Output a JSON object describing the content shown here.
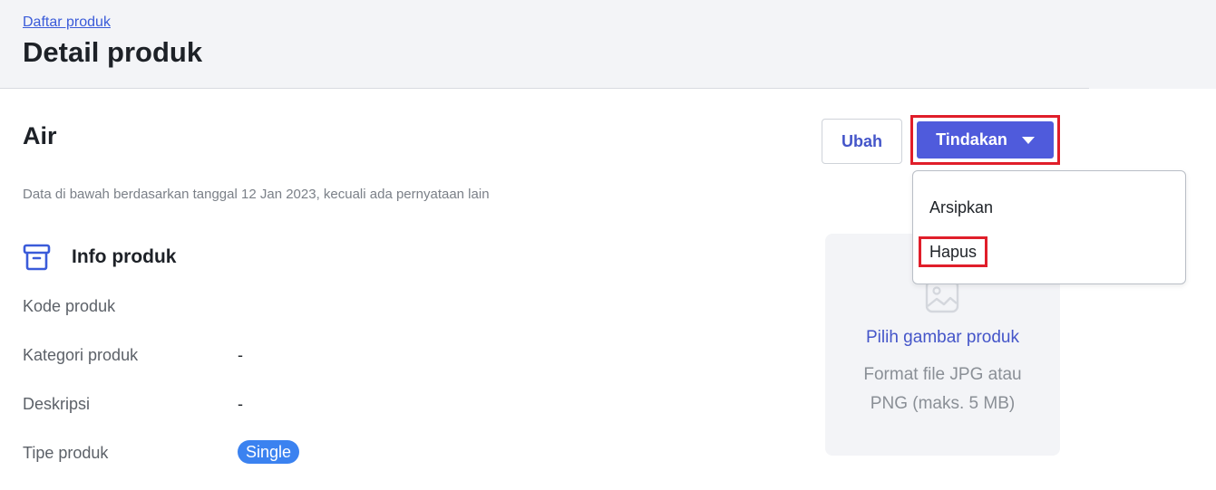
{
  "header": {
    "breadcrumb": "Daftar produk",
    "title": "Detail produk"
  },
  "product": {
    "name": "Air",
    "note": "Data di bawah berdasarkan tanggal 12 Jan 2023, kecuali ada pernyataan lain"
  },
  "actions": {
    "edit_label": "Ubah",
    "menu_label": "Tindakan",
    "menu_items": [
      "Arsipkan",
      "Hapus"
    ]
  },
  "info": {
    "section_title": "Info produk",
    "rows": [
      {
        "label": "Kode produk",
        "value": ""
      },
      {
        "label": "Kategori produk",
        "value": "-"
      },
      {
        "label": "Deskripsi",
        "value": "-"
      },
      {
        "label": "Tipe produk",
        "value": "Single"
      }
    ]
  },
  "image_upload": {
    "link": "Pilih gambar produk",
    "hint_line1": "Format file JPG atau",
    "hint_line2": "PNG (maks. 5 MB)"
  },
  "colors": {
    "primary": "#4f5bdc",
    "highlight": "#e01e2a",
    "badge": "#3b82f0"
  }
}
